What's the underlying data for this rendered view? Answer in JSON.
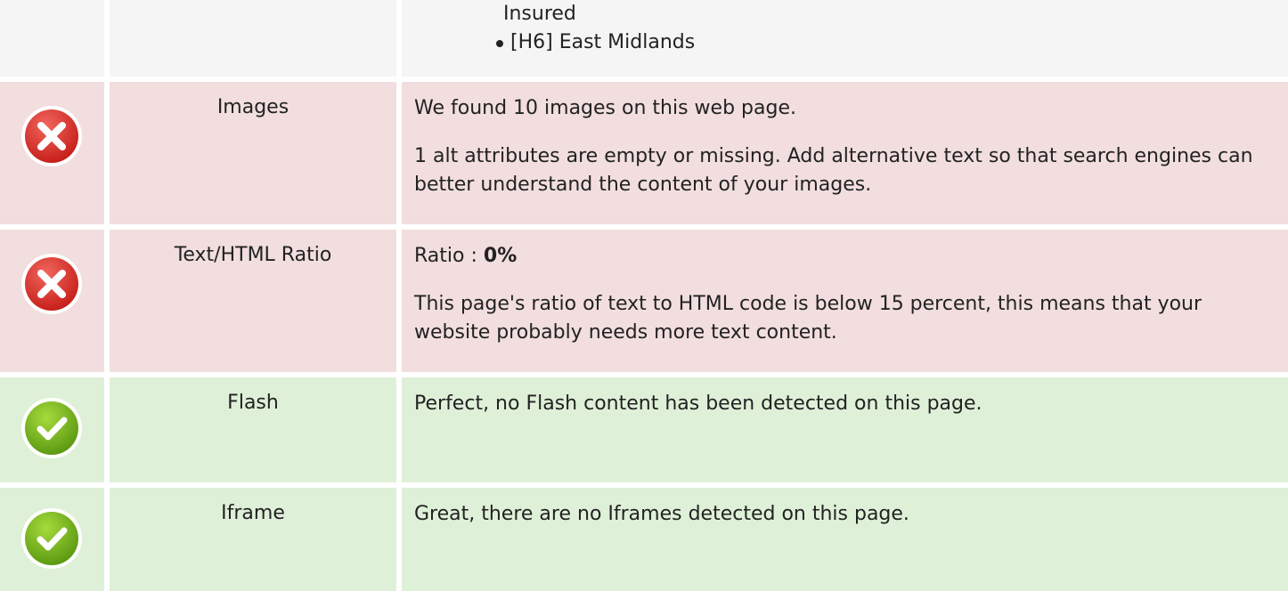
{
  "headings_continuation": {
    "trailing_text": "Insured",
    "items": [
      "[H6] East Midlands"
    ]
  },
  "checks": [
    {
      "status": "error",
      "icon": "error-x-icon",
      "label": "Images",
      "lines": [
        "We found 10 images on this web page.",
        "1 alt attributes are empty or missing. Add alternative text so that search engines can better understand the content of your images."
      ]
    },
    {
      "status": "error",
      "icon": "error-x-icon",
      "label": "Text/HTML Ratio",
      "ratio_prefix": "Ratio : ",
      "ratio_value": "0%",
      "lines": [
        "This page's ratio of text to HTML code is below 15 percent, this means that your website probably needs more text content."
      ]
    },
    {
      "status": "ok",
      "icon": "checkmark-icon",
      "label": "Flash",
      "lines": [
        "Perfect, no Flash content has been detected on this page."
      ]
    },
    {
      "status": "ok",
      "icon": "checkmark-icon",
      "label": "Iframe",
      "lines": [
        "Great, there are no Iframes detected on this page."
      ]
    }
  ],
  "colors": {
    "neutral_bg": "#f5f5f5",
    "error_bg": "#f2dede",
    "ok_bg": "#dff0d8",
    "error_icon": "#d9302a",
    "ok_icon": "#7cbd1f"
  }
}
